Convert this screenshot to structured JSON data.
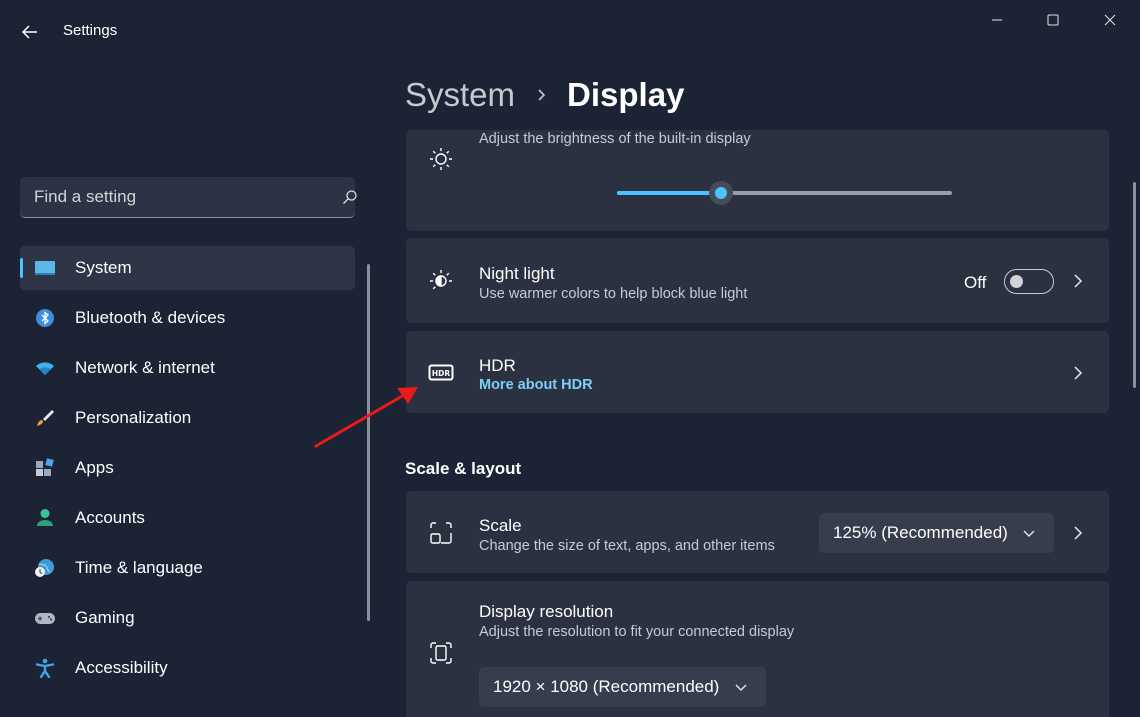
{
  "app": {
    "title": "Settings"
  },
  "search": {
    "placeholder": "Find a setting"
  },
  "nav": {
    "items": [
      {
        "label": "System",
        "icon": "monitor-icon",
        "active": true
      },
      {
        "label": "Bluetooth & devices",
        "icon": "bluetooth-icon"
      },
      {
        "label": "Network & internet",
        "icon": "wifi-icon"
      },
      {
        "label": "Personalization",
        "icon": "brush-icon"
      },
      {
        "label": "Apps",
        "icon": "apps-icon"
      },
      {
        "label": "Accounts",
        "icon": "person-icon"
      },
      {
        "label": "Time & language",
        "icon": "globe-clock-icon"
      },
      {
        "label": "Gaming",
        "icon": "gamepad-icon"
      },
      {
        "label": "Accessibility",
        "icon": "accessibility-icon"
      }
    ]
  },
  "breadcrumb": {
    "parent": "System",
    "current": "Display"
  },
  "brightness": {
    "subtitle": "Adjust the brightness of the built-in display",
    "value": 0.31
  },
  "night_light": {
    "title": "Night light",
    "subtitle": "Use warmer colors to help block blue light",
    "state": "Off"
  },
  "hdr": {
    "title": "HDR",
    "link": "More about HDR"
  },
  "scale_layout": {
    "title": "Scale & layout",
    "scale": {
      "title": "Scale",
      "subtitle": "Change the size of text, apps, and other items",
      "value": "125% (Recommended)"
    },
    "resolution": {
      "title": "Display resolution",
      "subtitle": "Adjust the resolution to fit your connected display",
      "value": "1920 × 1080 (Recommended)"
    }
  },
  "colors": {
    "accent": "#4cc2ff",
    "background": "#1c2334",
    "card": "#2b3141",
    "annotation": "#e81b1b"
  }
}
